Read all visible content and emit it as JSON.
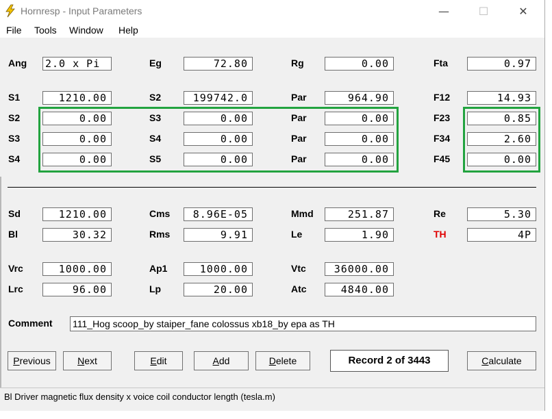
{
  "window": {
    "title": "Hornresp - Input Parameters",
    "minimize_glyph": "—",
    "maximize_glyph": "☐",
    "close_glyph": "✕"
  },
  "menu": {
    "items": [
      {
        "label": "File"
      },
      {
        "label": "Tools"
      },
      {
        "label": "Window"
      },
      {
        "label": "Help"
      }
    ]
  },
  "params": {
    "Ang": {
      "label": "Ang",
      "value": "2.0 x Pi"
    },
    "Eg": {
      "label": "Eg",
      "value": "72.80"
    },
    "Rg": {
      "label": "Rg",
      "value": "0.00"
    },
    "Fta": {
      "label": "Fta",
      "value": "0.97"
    },
    "S1": {
      "label": "S1",
      "value": "1210.00"
    },
    "S2a": {
      "label": "S2",
      "value": "199742.0"
    },
    "Par1": {
      "label": "Par",
      "value": "964.90"
    },
    "F12": {
      "label": "F12",
      "value": "14.93"
    },
    "S2": {
      "label": "S2",
      "value": "0.00"
    },
    "S3a": {
      "label": "S3",
      "value": "0.00"
    },
    "Par2": {
      "label": "Par",
      "value": "0.00"
    },
    "F23": {
      "label": "F23",
      "value": "0.85"
    },
    "S3": {
      "label": "S3",
      "value": "0.00"
    },
    "S4a": {
      "label": "S4",
      "value": "0.00"
    },
    "Par3": {
      "label": "Par",
      "value": "0.00"
    },
    "F34": {
      "label": "F34",
      "value": "2.60"
    },
    "S4": {
      "label": "S4",
      "value": "0.00"
    },
    "S5": {
      "label": "S5",
      "value": "0.00"
    },
    "Par4": {
      "label": "Par",
      "value": "0.00"
    },
    "F45": {
      "label": "F45",
      "value": "0.00"
    },
    "Sd": {
      "label": "Sd",
      "value": "1210.00"
    },
    "Cms": {
      "label": "Cms",
      "value": "8.96E-05"
    },
    "Mmd": {
      "label": "Mmd",
      "value": "251.87"
    },
    "Re": {
      "label": "Re",
      "value": "5.30"
    },
    "Bl": {
      "label": "Bl",
      "value": "30.32"
    },
    "Rms": {
      "label": "Rms",
      "value": "9.91"
    },
    "Le": {
      "label": "Le",
      "value": "1.90"
    },
    "TH": {
      "label": "TH",
      "value": "4P"
    },
    "Vrc": {
      "label": "Vrc",
      "value": "1000.00"
    },
    "Ap1": {
      "label": "Ap1",
      "value": "1000.00"
    },
    "Vtc": {
      "label": "Vtc",
      "value": "36000.00"
    },
    "Lrc": {
      "label": "Lrc",
      "value": "96.00"
    },
    "Lp": {
      "label": "Lp",
      "value": "20.00"
    },
    "Atc": {
      "label": "Atc",
      "value": "4840.00"
    }
  },
  "comment": {
    "label": "Comment",
    "value": "111_Hog scoop_by staiper_fane colossus xb18_by epa as TH"
  },
  "buttons": {
    "previous": {
      "u": "P",
      "rest": "revious"
    },
    "next": {
      "u": "N",
      "rest": "ext"
    },
    "edit": {
      "u": "E",
      "rest": "dit"
    },
    "add": {
      "u": "A",
      "rest": "dd"
    },
    "delete": {
      "u": "D",
      "rest": "elete"
    },
    "calculate": {
      "u": "C",
      "rest": "alculate"
    }
  },
  "record": "Record 2 of 3443",
  "status": "Bl  Driver magnetic flux density x voice coil conductor length  (tesla.m)",
  "colors": {
    "highlight_box": "#22a33f",
    "th_label": "#e00000",
    "app_icon": "#f5c400"
  }
}
